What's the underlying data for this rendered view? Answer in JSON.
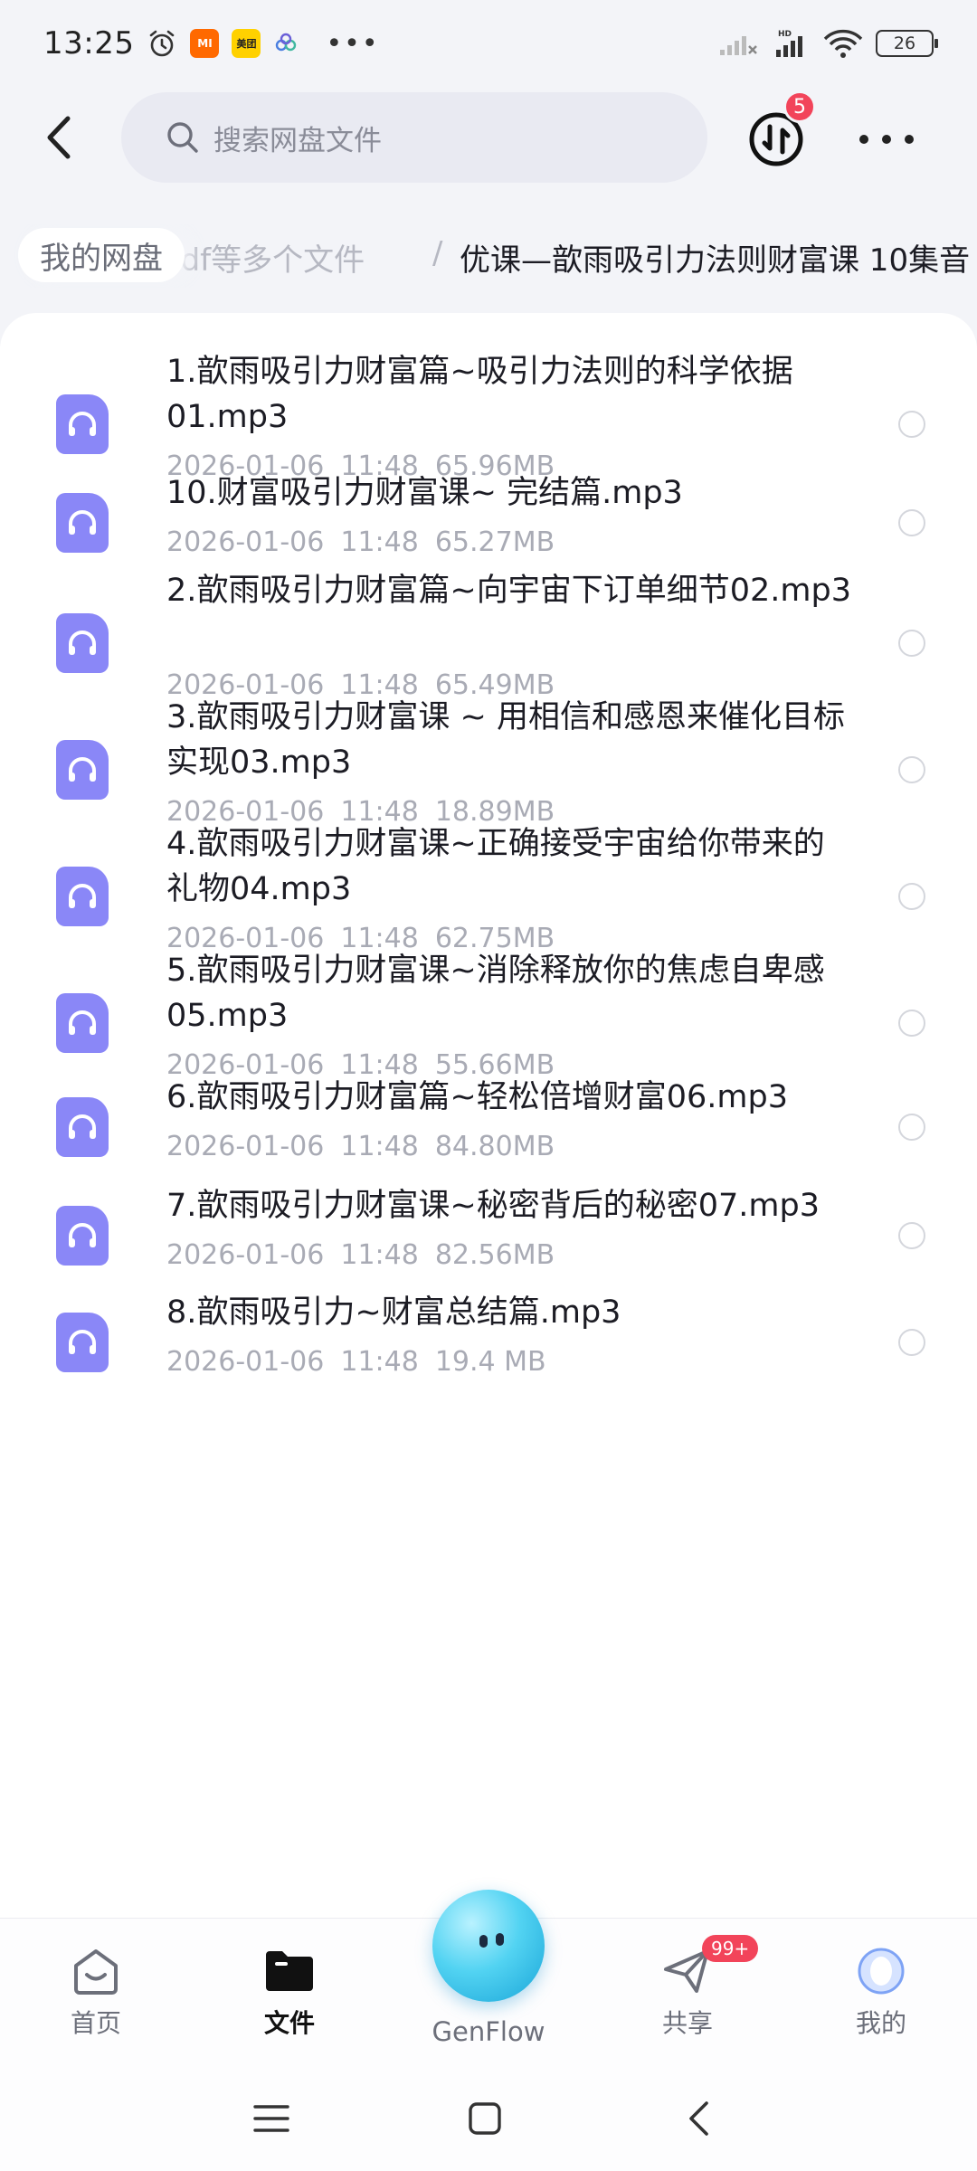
{
  "status_bar": {
    "time": "13:25",
    "app_mi": "MI",
    "app_meituan": "美团",
    "more": "•••",
    "battery": "26"
  },
  "header": {
    "search_placeholder": "搜索网盘文件",
    "transfer_badge": "5"
  },
  "breadcrumb": {
    "root": "我的网盘",
    "middle": "pdf等多个文件",
    "separator": "/",
    "current": "优课—歆雨吸引力法则财富课 10集音"
  },
  "files": [
    {
      "name": "1.歆雨吸引力财富篇~吸引力法则的科学依据01.mp3",
      "date": "2026-01-06",
      "time": "11:48",
      "size": "65.96MB"
    },
    {
      "name": "10.财富吸引力财富课~ 完结篇.mp3",
      "date": "2026-01-06",
      "time": "11:48",
      "size": "65.27MB"
    },
    {
      "name": "2.歆雨吸引力财富篇~向宇宙下订单细节02.mp3",
      "date": "2026-01-06",
      "time": "11:48",
      "size": "65.49MB"
    },
    {
      "name": "3.歆雨吸引力财富课 ~ 用相信和感恩来催化目标实现03.mp3",
      "date": "2026-01-06",
      "time": "11:48",
      "size": "18.89MB"
    },
    {
      "name": "4.歆雨吸引力财富课~正确接受宇宙给你带来的礼物04.mp3",
      "date": "2026-01-06",
      "time": "11:48",
      "size": "62.75MB"
    },
    {
      "name": "5.歆雨吸引力财富课~消除释放你的焦虑自卑感05.mp3",
      "date": "2026-01-06",
      "time": "11:48",
      "size": "55.66MB"
    },
    {
      "name": "6.歆雨吸引力财富篇~轻松倍增财富06.mp3",
      "date": "2026-01-06",
      "time": "11:48",
      "size": "84.80MB"
    },
    {
      "name": "7.歆雨吸引力财富课~秘密背后的秘密07.mp3",
      "date": "2026-01-06",
      "time": "11:48",
      "size": "82.56MB"
    },
    {
      "name": "8.歆雨吸引力~财富总结篇.mp3",
      "date": "2026-01-06",
      "time": "11:48",
      "size": "19.4 MB"
    }
  ],
  "bottom_nav": {
    "home": "首页",
    "files": "文件",
    "genflow": "GenFlow",
    "share": "共享",
    "share_badge": "99+",
    "mine": "我的"
  },
  "colors": {
    "accent_icon": "#8a87f7",
    "badge": "#f2445a",
    "background": "#f3f4f8"
  }
}
